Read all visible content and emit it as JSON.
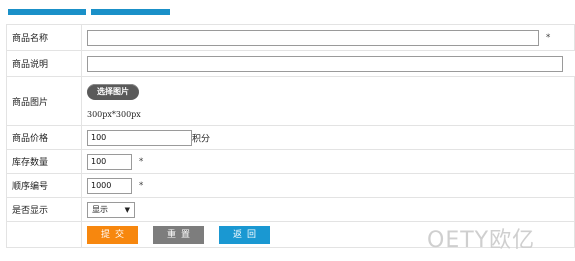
{
  "tabs": {
    "color": "#1a90c8"
  },
  "form": {
    "name": {
      "label": "商品名称",
      "value": "",
      "required_mark": "*"
    },
    "description": {
      "label": "商品说明",
      "value": ""
    },
    "image": {
      "label": "商品图片",
      "button_label": "选择图片",
      "size_hint": "300px*300px"
    },
    "price": {
      "label": "商品价格",
      "value": "100",
      "unit": "积分"
    },
    "stock": {
      "label": "库存数量",
      "value": "100",
      "required_mark": "*"
    },
    "order": {
      "label": "顺序编号",
      "value": "1000",
      "required_mark": "*"
    },
    "display": {
      "label": "是否显示",
      "selected": "显示",
      "caret": "▼"
    }
  },
  "actions": {
    "submit_label": "提交",
    "reset_label": "重置",
    "back_label": "返回",
    "submit_color": "#f7870e",
    "reset_color": "#7d7d7d",
    "back_color": "#1a98d2"
  },
  "watermark": "OETY欧亿"
}
